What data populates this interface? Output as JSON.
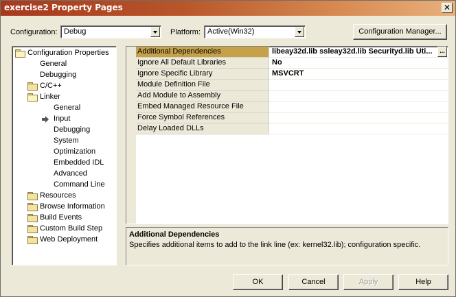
{
  "window": {
    "title": "exercise2 Property Pages",
    "close_glyph": "✕"
  },
  "config": {
    "configuration_label": "Configuration:",
    "configuration_value": "Debug",
    "platform_label": "Platform:",
    "platform_value": "Active(Win32)",
    "manager_button": "Configuration Manager..."
  },
  "tree": {
    "items": [
      {
        "label": "Configuration Properties",
        "icon": "folder-open-icon"
      },
      {
        "label": "General"
      },
      {
        "label": "Debugging"
      },
      {
        "label": "C/C++",
        "icon": "folder-icon"
      },
      {
        "label": "Linker",
        "icon": "folder-open-icon"
      },
      {
        "label": "General"
      },
      {
        "label": "Input",
        "icon": "arrow-right-icon"
      },
      {
        "label": "Debugging"
      },
      {
        "label": "System"
      },
      {
        "label": "Optimization"
      },
      {
        "label": "Embedded IDL"
      },
      {
        "label": "Advanced"
      },
      {
        "label": "Command Line"
      },
      {
        "label": "Resources",
        "icon": "folder-icon"
      },
      {
        "label": "Browse Information",
        "icon": "folder-icon"
      },
      {
        "label": "Build Events",
        "icon": "folder-icon"
      },
      {
        "label": "Custom Build Step",
        "icon": "folder-icon"
      },
      {
        "label": "Web Deployment",
        "icon": "folder-icon"
      }
    ]
  },
  "properties": {
    "rows": [
      {
        "name": "Additional Dependencies",
        "value": "libeay32d.lib ssleay32d.lib Securityd.lib Uti...",
        "selected": true,
        "ellipsis": "..."
      },
      {
        "name": "Ignore All Default Libraries",
        "value": "No"
      },
      {
        "name": "Ignore Specific Library",
        "value": "MSVCRT"
      },
      {
        "name": "Module Definition File",
        "value": ""
      },
      {
        "name": "Add Module to Assembly",
        "value": ""
      },
      {
        "name": "Embed Managed Resource File",
        "value": ""
      },
      {
        "name": "Force Symbol References",
        "value": ""
      },
      {
        "name": "Delay Loaded DLLs",
        "value": ""
      }
    ]
  },
  "description": {
    "title": "Additional Dependencies",
    "text": "Specifies additional items to add to the link line (ex: kernel32.lib); configuration specific."
  },
  "buttons": {
    "ok": "OK",
    "cancel": "Cancel",
    "apply": "Apply",
    "help": "Help"
  },
  "colors": {
    "titlebar_start": "#a7381e",
    "titlebar_end": "#e8b07c",
    "selection": "#c5a24a",
    "dialog_bg": "#ece9d8"
  }
}
